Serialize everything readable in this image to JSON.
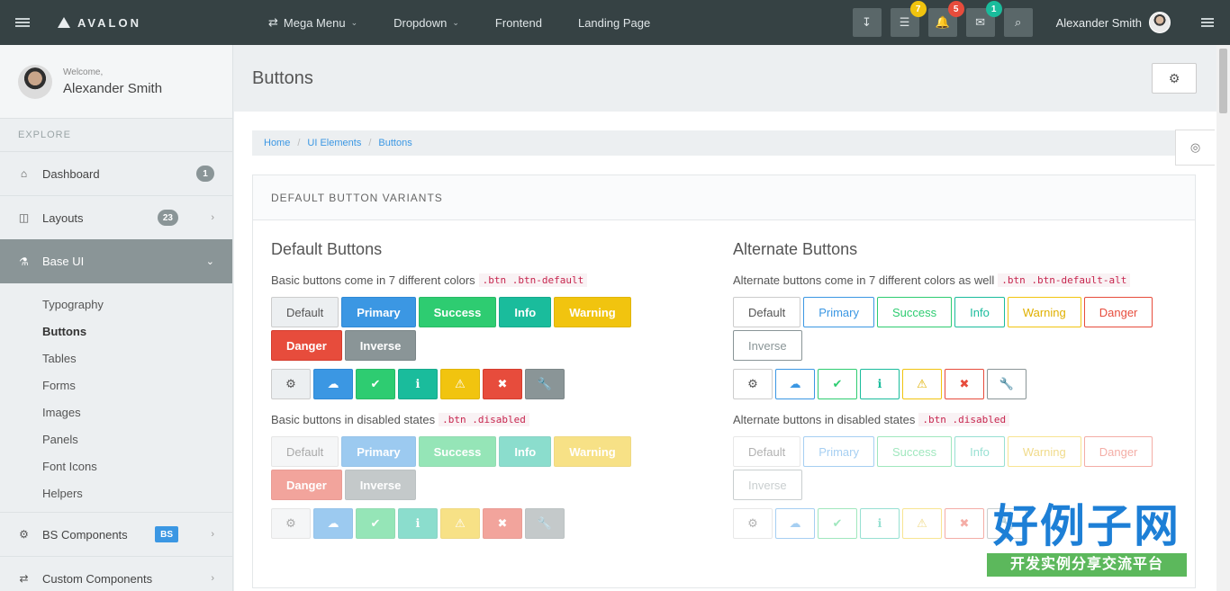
{
  "topbar": {
    "brand": "AVALON",
    "nav": [
      {
        "label": "Mega Menu",
        "icon": "shuffle-icon",
        "chevron": true
      },
      {
        "label": "Dropdown",
        "chevron": true
      },
      {
        "label": "Frontend"
      },
      {
        "label": "Landing Page"
      }
    ],
    "icons": [
      {
        "name": "download-icon",
        "glyph": "↧",
        "badge": ""
      },
      {
        "name": "tasks-icon",
        "glyph": "☰",
        "badge": "7",
        "badge_color": "#f1c40f"
      },
      {
        "name": "bell-icon",
        "glyph": "🔔",
        "badge": "5",
        "badge_color": "#e74c3c"
      },
      {
        "name": "envelope-icon",
        "glyph": "✉",
        "badge": "1",
        "badge_color": "#1abc9c"
      },
      {
        "name": "search-icon",
        "glyph": "⌕",
        "badge": ""
      }
    ],
    "user_name": "Alexander Smith"
  },
  "sidebar": {
    "welcome": "Welcome,",
    "user_name": "Alexander Smith",
    "heading": "EXPLORE",
    "items": [
      {
        "label": "Dashboard",
        "icon": "home-icon",
        "glyph": "⌂",
        "badge": "1"
      },
      {
        "label": "Layouts",
        "icon": "columns-icon",
        "glyph": "◫",
        "badge": "23",
        "chevron": "›"
      },
      {
        "label": "Base UI",
        "icon": "flask-icon",
        "glyph": "⚗",
        "active": true,
        "chevron": "⌄"
      }
    ],
    "submenu": [
      "Typography",
      "Buttons",
      "Tables",
      "Forms",
      "Images",
      "Panels",
      "Font Icons",
      "Helpers"
    ],
    "current_sub": "Buttons",
    "items_after": [
      {
        "label": "BS Components",
        "icon": "cogs-icon",
        "glyph": "⚙",
        "badge": "BS",
        "chevron": "›"
      },
      {
        "label": "Custom Components",
        "icon": "random-icon",
        "glyph": "⇄",
        "chevron": "›"
      }
    ]
  },
  "page": {
    "title": "Buttons",
    "breadcrumb": [
      "Home",
      "UI Elements",
      "Buttons"
    ]
  },
  "panel": {
    "title": "DEFAULT BUTTON VARIANTS",
    "left": {
      "heading": "Default Buttons",
      "desc": "Basic buttons come in 7 different colors",
      "code": ".btn .btn-default",
      "disabled_desc": "Basic buttons in disabled states",
      "disabled_code": ".btn .disabled"
    },
    "right": {
      "heading": "Alternate Buttons",
      "desc": "Alternate buttons come in 7 different colors as well",
      "code": ".btn .btn-default-alt",
      "disabled_desc": "Alternate buttons in disabled states",
      "disabled_code": ".btn .disabled"
    },
    "buttons": [
      {
        "label": "Default",
        "variant": "default"
      },
      {
        "label": "Primary",
        "variant": "primary"
      },
      {
        "label": "Success",
        "variant": "success"
      },
      {
        "label": "Info",
        "variant": "info"
      },
      {
        "label": "Warning",
        "variant": "warning"
      },
      {
        "label": "Danger",
        "variant": "danger"
      },
      {
        "label": "Inverse",
        "variant": "inverse"
      }
    ],
    "icon_buttons": [
      {
        "icon": "gear-icon",
        "glyph": "⚙",
        "variant": "default"
      },
      {
        "icon": "cloud-icon",
        "glyph": "☁",
        "variant": "primary"
      },
      {
        "icon": "check-icon",
        "glyph": "✔",
        "variant": "success"
      },
      {
        "icon": "info-icon",
        "glyph": "ℹ",
        "variant": "info"
      },
      {
        "icon": "warning-icon",
        "glyph": "⚠",
        "variant": "warning"
      },
      {
        "icon": "close-icon",
        "glyph": "✖",
        "variant": "danger"
      },
      {
        "icon": "wrench-icon",
        "glyph": "🔧",
        "variant": "inverse"
      }
    ]
  },
  "watermark": {
    "big": "好例子网",
    "small": "开发实例分享交流平台"
  }
}
